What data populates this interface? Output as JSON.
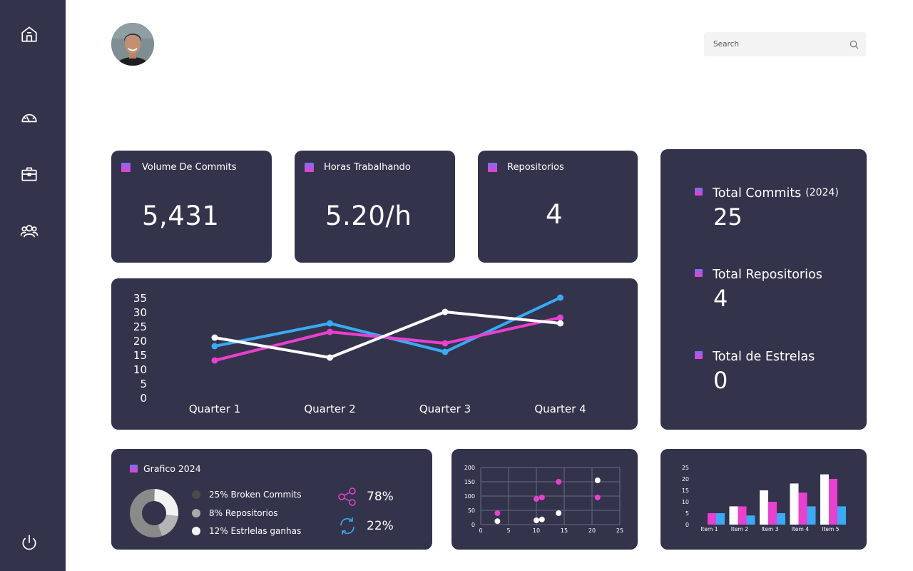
{
  "nav": {
    "items": [
      {
        "name": "home-icon"
      },
      {
        "name": "dashboard-gauge-icon"
      },
      {
        "name": "briefcase-icon"
      },
      {
        "name": "users-icon"
      },
      {
        "name": "power-icon"
      }
    ]
  },
  "search": {
    "placeholder": "Search"
  },
  "kpis": [
    {
      "title": "Volume De Commits",
      "value": "5,431"
    },
    {
      "title": "Horas Trabalhando",
      "value": "5.20/h"
    },
    {
      "title": "Repositorios",
      "value": "4"
    }
  ],
  "totals": {
    "commits": {
      "label": "Total Commits",
      "year": "(2024)",
      "value": "25"
    },
    "repos": {
      "label": "Total Repositorios",
      "value": "4"
    },
    "stars": {
      "label": "Total de Estrelas",
      "value": "0"
    }
  },
  "donut": {
    "title": "Grafico 2024",
    "legend": [
      {
        "text": "25% Broken Commits",
        "color": "#4a4a4a"
      },
      {
        "text": "8% Repositorios",
        "color": "#a9a9a9"
      },
      {
        "text": "12% Estrlelas ganhas",
        "color": "#f2f2f2"
      }
    ]
  },
  "stats": {
    "shares": {
      "value": "78%",
      "icon": "share-icon"
    },
    "sync": {
      "value": "22%",
      "icon": "sync-icon"
    }
  },
  "colors": {
    "pink": "#ea3fcf",
    "blue": "#38aaf6",
    "white": "#ffffff",
    "card": "#33344b"
  },
  "chart_data": [
    {
      "type": "line",
      "categories": [
        "Quarter 1",
        "Quarter 2",
        "Quarter 3",
        "Quarter 4"
      ],
      "y_ticks": [
        0,
        5,
        10,
        15,
        20,
        25,
        30,
        35
      ],
      "ylim": [
        0,
        35
      ],
      "series": [
        {
          "color": "#38aaf6",
          "values": [
            18,
            26,
            16,
            35
          ]
        },
        {
          "color": "#ea3fcf",
          "values": [
            13,
            23,
            19,
            28
          ]
        },
        {
          "color": "#ffffff",
          "values": [
            21,
            14,
            30,
            26
          ]
        }
      ]
    },
    {
      "type": "pie",
      "slices": [
        {
          "label": "25% Broken Commits",
          "value": 25,
          "color": "#8a8a8a"
        },
        {
          "label": "8% Repositorios",
          "value": 8,
          "color": "#b4b4b4"
        },
        {
          "label": "12% Estrlelas ganhas",
          "value": 12,
          "color": "#f2f2f2"
        }
      ]
    },
    {
      "type": "scatter",
      "xlim": [
        0,
        25
      ],
      "ylim": [
        0,
        200
      ],
      "x_ticks": [
        0,
        5,
        10,
        15,
        20,
        25
      ],
      "y_ticks": [
        0,
        50,
        100,
        150,
        200
      ],
      "grid": true,
      "series": [
        {
          "color": "#ea3fcf",
          "points": [
            [
              3,
              40
            ],
            [
              10,
              90
            ],
            [
              11,
              95
            ],
            [
              14,
              150
            ],
            [
              21,
              95
            ]
          ]
        },
        {
          "color": "#ffffff",
          "points": [
            [
              3,
              12
            ],
            [
              10,
              15
            ],
            [
              11,
              18
            ],
            [
              14,
              40
            ],
            [
              21,
              155
            ]
          ]
        }
      ]
    },
    {
      "type": "bar",
      "categories": [
        "Item 1",
        "Item 2",
        "Item 3",
        "Item 4",
        "Item 5"
      ],
      "y_ticks": [
        0,
        5,
        10,
        15,
        20,
        25
      ],
      "ylim": [
        0,
        25
      ],
      "series": [
        {
          "color": "#ea3fcf",
          "values": [
            5,
            8,
            10,
            14,
            20
          ]
        },
        {
          "color": "#38aaf6",
          "values": [
            5,
            4,
            5,
            8,
            8
          ]
        },
        {
          "color": "#ffffff",
          "values": [
            0,
            8,
            15,
            18,
            22
          ]
        }
      ]
    }
  ]
}
